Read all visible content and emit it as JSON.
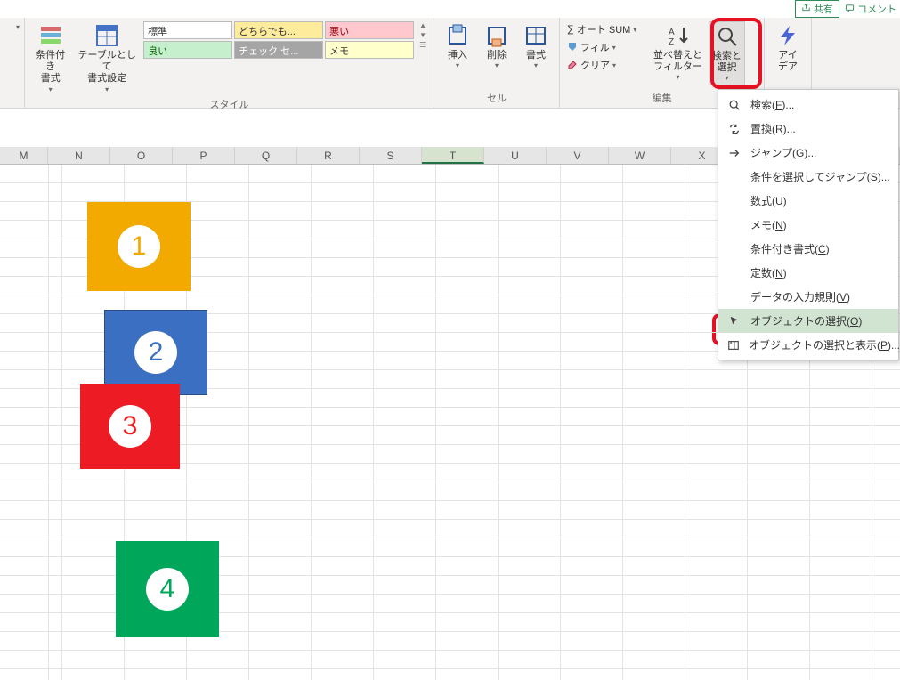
{
  "titlebar": {
    "share": "共有",
    "comment": "コメント"
  },
  "ribbon": {
    "styles": {
      "cond_format": "条件付き\n書式",
      "table_format": "テーブルとして\n書式設定",
      "cells": {
        "normal": "標準",
        "neutral": "どちらでも...",
        "bad": "悪い",
        "good": "良い",
        "check": "チェック セ...",
        "memo": "メモ"
      },
      "label": "スタイル"
    },
    "cells_group": {
      "insert": "挿入",
      "delete": "削除",
      "format": "書式",
      "label": "セル"
    },
    "editing": {
      "autosum": "オート SUM",
      "fill": "フィル",
      "clear": "クリア",
      "sort": "並べ替えと\nフィルター",
      "find": "検索と\n選択",
      "label": "編集"
    },
    "ideas": {
      "label": "アイ\nデア"
    }
  },
  "menu": {
    "find": "検索(F)...",
    "replace": "置換(R)...",
    "goto": "ジャンプ(G)...",
    "goto_special": "条件を選択してジャンプ(S)...",
    "formulas": "数式(U)",
    "memo": "メモ(N)",
    "cond_format": "条件付き書式(C)",
    "constants": "定数(N)",
    "validation": "データの入力規則(V)",
    "select_objects": "オブジェクトの選択(O)",
    "selection_pane": "オブジェクトの選択と表示(P)..."
  },
  "hotkeys": {
    "find": "F",
    "replace": "R",
    "goto": "G",
    "goto_special": "S",
    "formulas": "U",
    "memo": "N",
    "cond_format": "C",
    "constants": "N",
    "validation": "V",
    "select_objects": "O",
    "selection_pane": "P"
  },
  "columns": [
    "M",
    "N",
    "O",
    "P",
    "Q",
    "R",
    "S",
    "T",
    "U",
    "V",
    "W",
    "X"
  ],
  "selected_col": "T",
  "shapes": {
    "n1": "1",
    "n2": "2",
    "n3": "3",
    "n4": "4"
  }
}
